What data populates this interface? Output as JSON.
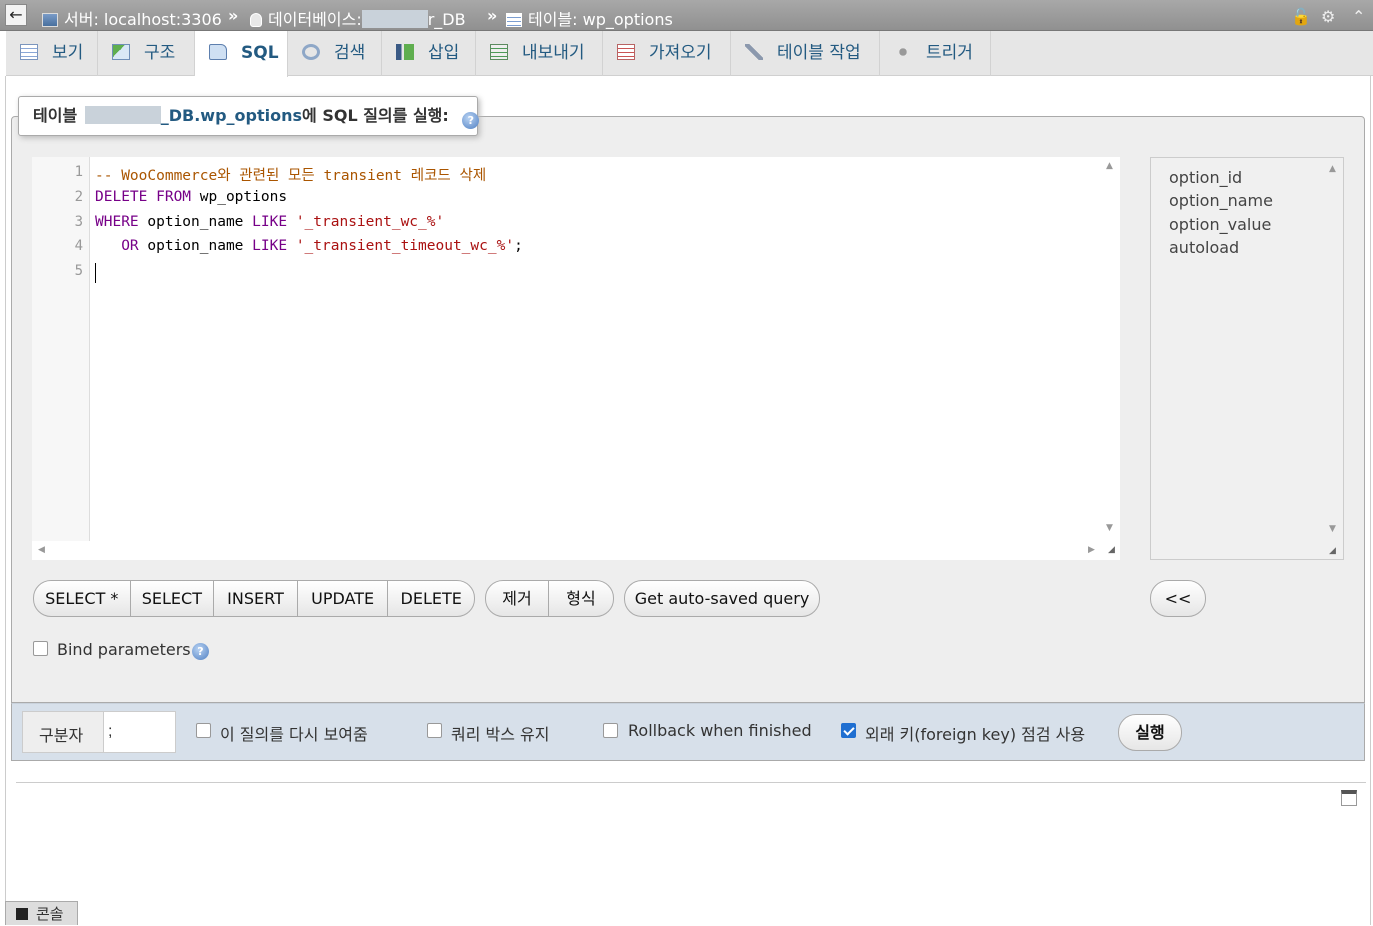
{
  "breadcrumb": {
    "back_glyph": "←",
    "server": "서버: localhost:3306",
    "sep1": "»",
    "database_prefix": "데이터베이스:",
    "database_suffix": "r_DB",
    "sep2": "»",
    "table": "테이블: wp_options",
    "lock_icon": "lock-icon",
    "settings_icon": "gear-icon",
    "collapse_icon": "chevron-up-icon"
  },
  "tabs": [
    {
      "label": "보기",
      "icon": "browse-icon"
    },
    {
      "label": "구조",
      "icon": "structure-icon"
    },
    {
      "label": "SQL",
      "icon": "sql-icon",
      "active": true
    },
    {
      "label": "검색",
      "icon": "search-icon"
    },
    {
      "label": "삽입",
      "icon": "insert-icon"
    },
    {
      "label": "내보내기",
      "icon": "export-icon"
    },
    {
      "label": "가져오기",
      "icon": "import-icon"
    },
    {
      "label": "테이블 작업",
      "icon": "wrench-icon"
    },
    {
      "label": "트리거",
      "icon": "trigger-icon"
    }
  ],
  "legend": {
    "prefix": "테이블",
    "table_name": "_DB.wp_options",
    "suffix": "에 SQL 질의를 실행:",
    "help_icon": "help-icon"
  },
  "editor": {
    "line_numbers": [
      "1",
      "2",
      "3",
      "4",
      "5"
    ],
    "lines": [
      [
        {
          "t": "-- WooCommerce와 관련된 모든 transient 레코드 삭제",
          "c": "cm"
        }
      ],
      [
        {
          "t": "DELETE FROM",
          "c": "kw"
        },
        {
          "t": " wp_options",
          "c": ""
        }
      ],
      [
        {
          "t": "WHERE",
          "c": "kw"
        },
        {
          "t": " option_name ",
          "c": ""
        },
        {
          "t": "LIKE",
          "c": "kw"
        },
        {
          "t": " ",
          "c": ""
        },
        {
          "t": "'_transient_wc_%'",
          "c": "str"
        }
      ],
      [
        {
          "t": "   OR",
          "c": "kw"
        },
        {
          "t": " option_name ",
          "c": ""
        },
        {
          "t": "LIKE",
          "c": "kw"
        },
        {
          "t": " ",
          "c": ""
        },
        {
          "t": "'_transient_timeout_wc_%'",
          "c": "str"
        },
        {
          "t": ";",
          "c": ""
        }
      ],
      []
    ]
  },
  "columns": [
    "option_id",
    "option_name",
    "option_value",
    "autoload"
  ],
  "query_buttons": [
    "SELECT *",
    "SELECT",
    "INSERT",
    "UPDATE",
    "DELETE"
  ],
  "edit_buttons": [
    "제거",
    "형식"
  ],
  "autosave_button": "Get auto-saved query",
  "insert_column_button": "<<",
  "bind_parameters": {
    "label": "Bind parameters",
    "checked": false
  },
  "bottom": {
    "delimiter_label": "구분자",
    "delimiter_value": ";",
    "show_query_label": "이 질의를 다시 보여줌",
    "retain_box_label": "쿼리 박스 유지",
    "rollback_label": "Rollback when finished",
    "fk_check_label": "외래 키(foreign key) 점검 사용",
    "fk_checked": true,
    "execute_button": "실행"
  },
  "console": {
    "label": "콘솔"
  }
}
